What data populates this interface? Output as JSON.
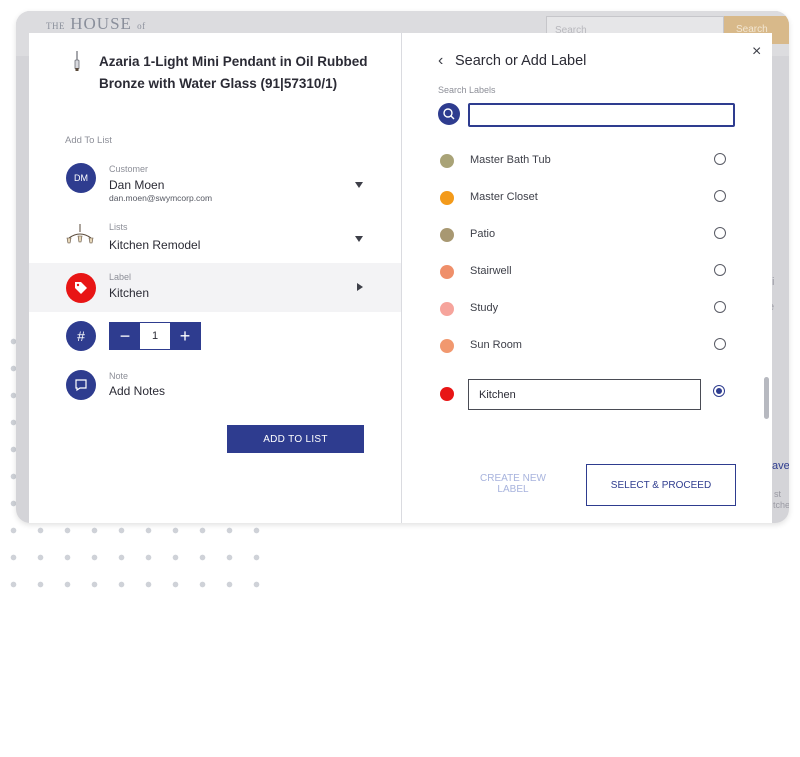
{
  "background": {
    "logo_small": "THE",
    "logo_main": "HOUSE",
    "logo_of": "of",
    "search_placeholder": "Search",
    "search_button": "Search",
    "side_text_1": "i",
    "side_text_2": "e",
    "side_text_3": "ave",
    "side_text_4": "st",
    "side_text_5": "tche"
  },
  "product": {
    "title": "Azaria 1-Light Mini Pendant in Oil Rubbed Bronze with Water Glass (91|57310/1)"
  },
  "add_to_list": {
    "section_label": "Add To List",
    "customer": {
      "caption": "Customer",
      "initials": "DM",
      "name": "Dan Moen",
      "email": "dan.moen@swymcorp.com"
    },
    "lists": {
      "caption": "Lists",
      "value": "Kitchen Remodel"
    },
    "label": {
      "caption": "Label",
      "value": "Kitchen"
    },
    "quantity": {
      "minus": "−",
      "value": "1",
      "plus": "+",
      "hash": "#"
    },
    "note": {
      "caption": "Note",
      "value": "Add Notes"
    },
    "add_button": "ADD TO LIST"
  },
  "label_panel": {
    "close": "×",
    "back": "‹",
    "title": "Search or Add Label",
    "search_caption": "Search Labels",
    "search_value": "",
    "labels": [
      {
        "name": "Master Bath Tub",
        "color": "#a9a377"
      },
      {
        "name": "Master Closet",
        "color": "#f39a1a"
      },
      {
        "name": "Patio",
        "color": "#a89872"
      },
      {
        "name": "Stairwell",
        "color": "#ef8f6a"
      },
      {
        "name": "Study",
        "color": "#f6a49c"
      },
      {
        "name": "Sun Room",
        "color": "#f1986f"
      }
    ],
    "new_label": {
      "value": "Kitchen",
      "color": "#e81515"
    },
    "create_new": "CREATE NEW LABEL",
    "select_proceed": "SELECT & PROCEED"
  },
  "colors": {
    "accent": "#2e3c8f"
  }
}
